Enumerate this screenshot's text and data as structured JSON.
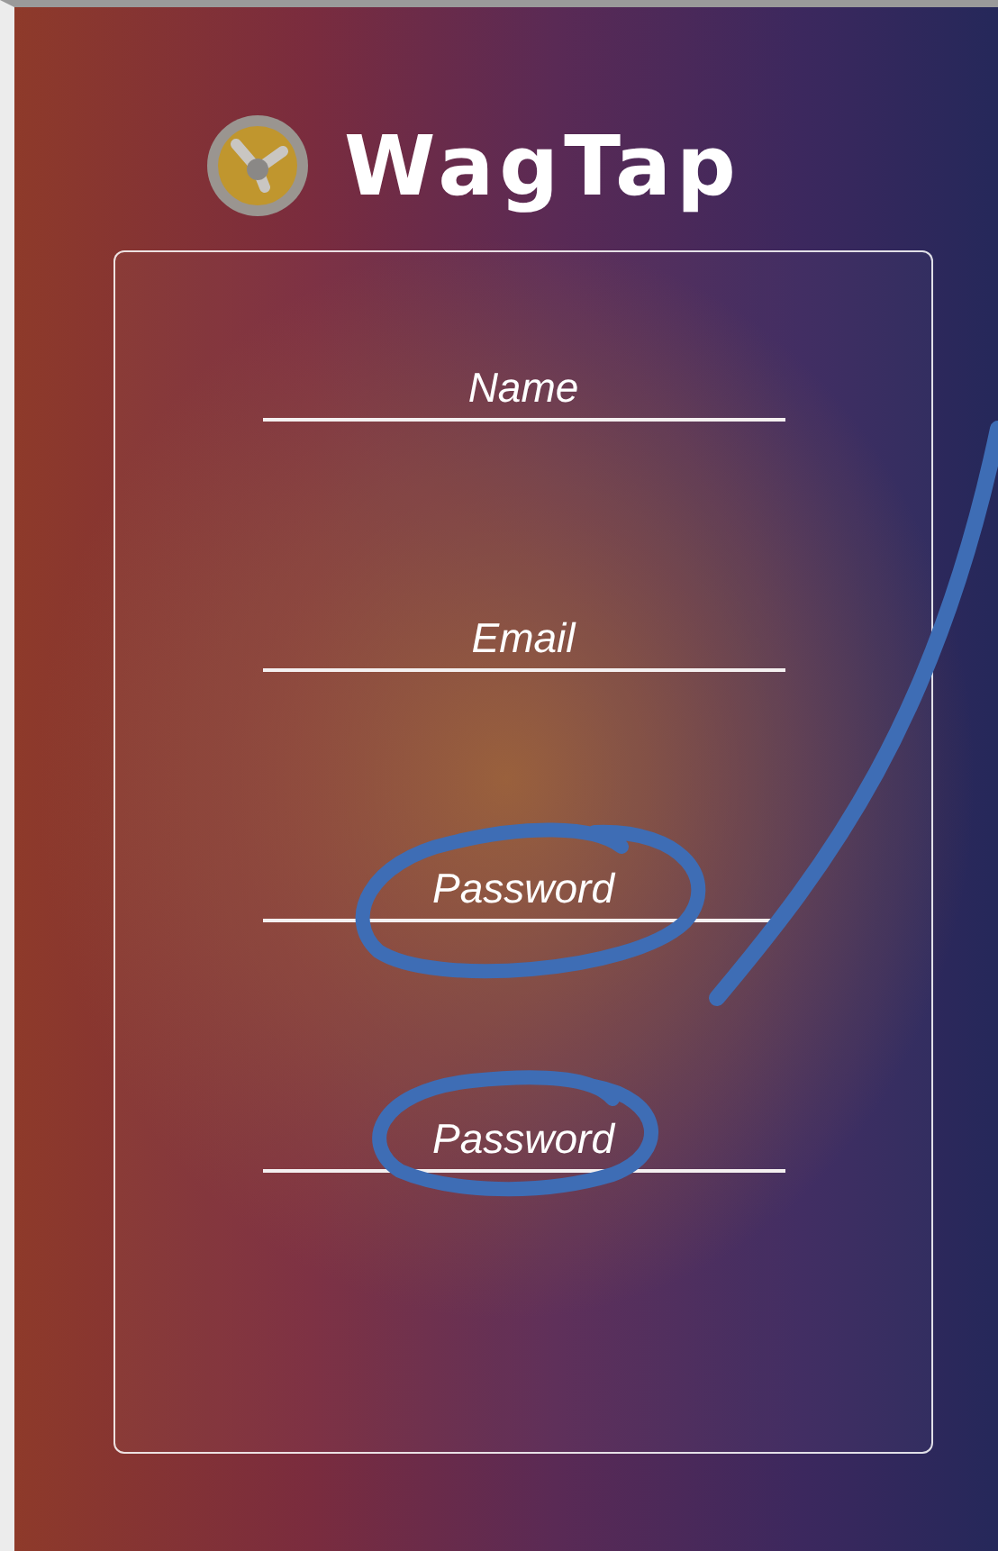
{
  "app": {
    "title": "WagTap"
  },
  "form": {
    "fields": [
      {
        "placeholder": "Name"
      },
      {
        "placeholder": "Email"
      },
      {
        "placeholder": "Password"
      },
      {
        "placeholder": "Password"
      }
    ]
  }
}
